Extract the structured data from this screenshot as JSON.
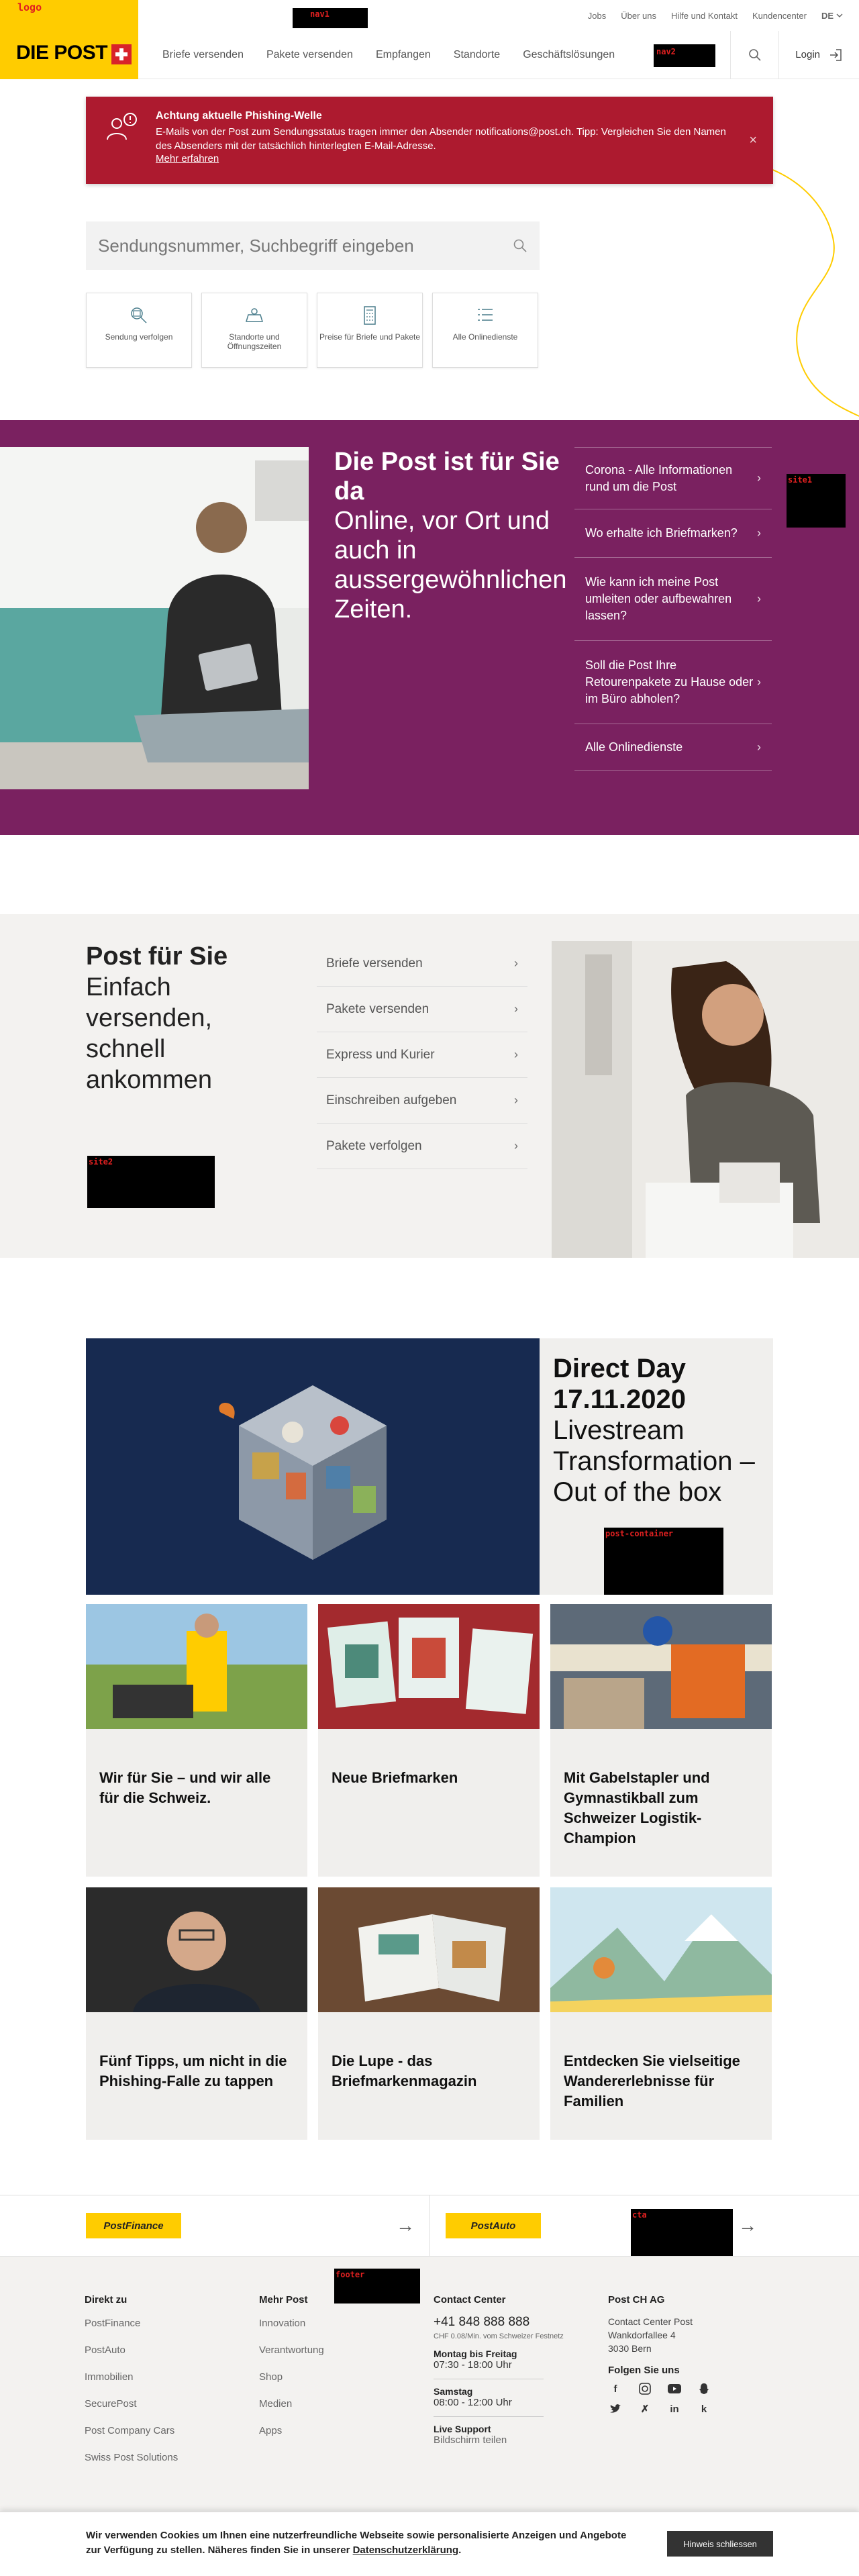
{
  "meta": {
    "links": [
      "Jobs",
      "Über uns",
      "Hilfe und Kontakt",
      "Kundencenter"
    ],
    "lang": "DE",
    "redacted_label": "nav1"
  },
  "logo": {
    "label": "logo",
    "text": "DIE POST"
  },
  "nav": {
    "items": [
      "Briefe versenden",
      "Pakete versenden",
      "Empfangen",
      "Standorte",
      "Geschäftslösungen"
    ],
    "redacted_label": "nav2",
    "login": "Login"
  },
  "alert": {
    "title": "Achtung aktuelle Phishing-Welle",
    "text": "E-Mails von der Post zum Sendungsstatus tragen immer den Absender notifications@post.ch. Tipp: Vergleichen Sie den Namen des Absenders mit der tatsächlich hinterlegten E-Mail-Adresse.",
    "link": "Mehr erfahren",
    "close": "×"
  },
  "search": {
    "placeholder": "Sendungsnummer, Suchbegriff eingeben"
  },
  "tiles": [
    {
      "label": "Sendung verfolgen",
      "icon": "track-icon"
    },
    {
      "label": "Standorte und Öffnungszeiten",
      "icon": "location-icon"
    },
    {
      "label": "Preise für Briefe und Pakete",
      "icon": "calculator-icon"
    },
    {
      "label": "Alle Onlinedienste",
      "icon": "list-icon"
    }
  ],
  "purple": {
    "title": "Die Post ist für Sie da",
    "subtitle": "Online, vor Ort und auch in aussergewöhnlichen Zeiten.",
    "items": [
      "Corona - Alle Informationen rund um die Post",
      "Wo erhalte ich Briefmarken?",
      "Wie kann ich meine Post umleiten oder aufbewahren lassen?",
      "Soll die Post Ihre Retourenpakete zu Hause oder im Büro abholen?",
      "Alle Onlinedienste"
    ],
    "redacted_label": "site1"
  },
  "pfs": {
    "title": "Post für Sie",
    "subtitle": "Einfach versenden, schnell ankommen",
    "items": [
      "Briefe versenden",
      "Pakete versenden",
      "Express und Kurier",
      "Einschreiben aufgeben",
      "Pakete verfolgen"
    ],
    "redacted_label": "site2"
  },
  "directday": {
    "title": "Direct Day 17.11.2020",
    "subtitle": "Livestream Transformation – Out of the box",
    "redacted_label": "post-container"
  },
  "cards": [
    "Wir für Sie – und wir alle für die Schweiz.",
    "Neue Briefmarken",
    "Mit Gabelstapler und Gymnastikball zum Schweizer Logistik-Champion",
    "Fünf Tipps, um nicht in die Phishing-Falle zu tappen",
    "Die Lupe - das Briefmarkenmagazin",
    "Entdecken Sie vielseitige Wandererlebnisse für Familien"
  ],
  "partners": {
    "postfinance": "PostFinance",
    "postauto": "PostAuto",
    "redacted_label": "cta"
  },
  "footer": {
    "col1": {
      "title": "Direkt zu",
      "links": [
        "PostFinance",
        "PostAuto",
        "Immobilien",
        "SecurePost",
        "Post Company Cars",
        "Swiss Post Solutions"
      ]
    },
    "col2": {
      "title": "Mehr Post",
      "links": [
        "Innovation",
        "Verantwortung",
        "Shop",
        "Medien",
        "Apps"
      ]
    },
    "redacted_label": "footer",
    "contact": {
      "title": "Contact Center",
      "phone": "+41 848 888 888",
      "note": "CHF 0.08/Min. vom Schweizer Festnetz",
      "weekday_label": "Montag bis Freitag",
      "weekday_hours": "07:30 - 18:00 Uhr",
      "sat_label": "Samstag",
      "sat_hours": "08:00 - 12:00 Uhr",
      "live_label": "Live Support",
      "live_value": "Bildschirm teilen"
    },
    "company": {
      "title": "Post CH AG",
      "address": [
        "Contact Center Post",
        "Wankdorfallee 4",
        "3030 Bern"
      ],
      "follow": "Folgen Sie uns",
      "social": [
        "facebook-icon",
        "instagram-icon",
        "youtube-icon",
        "snapchat-icon",
        "twitter-icon",
        "xing-icon",
        "linkedin-icon",
        "kununu-icon"
      ]
    }
  },
  "cookie": {
    "text": "Wir verwenden Cookies um Ihnen eine nutzerfreundliche Webseite sowie personalisierte Anzeigen und Angebote zur Verfügung zu stellen. Näheres finden Sie in unserer",
    "link": "Datenschutzerklärung",
    "end": ".",
    "button": "Hinweis schliessen"
  },
  "colors": {
    "brand_yellow": "#ffcc00",
    "alert_red": "#ad1a2f",
    "purple": "#7a2160",
    "post_red": "#d8232a"
  }
}
